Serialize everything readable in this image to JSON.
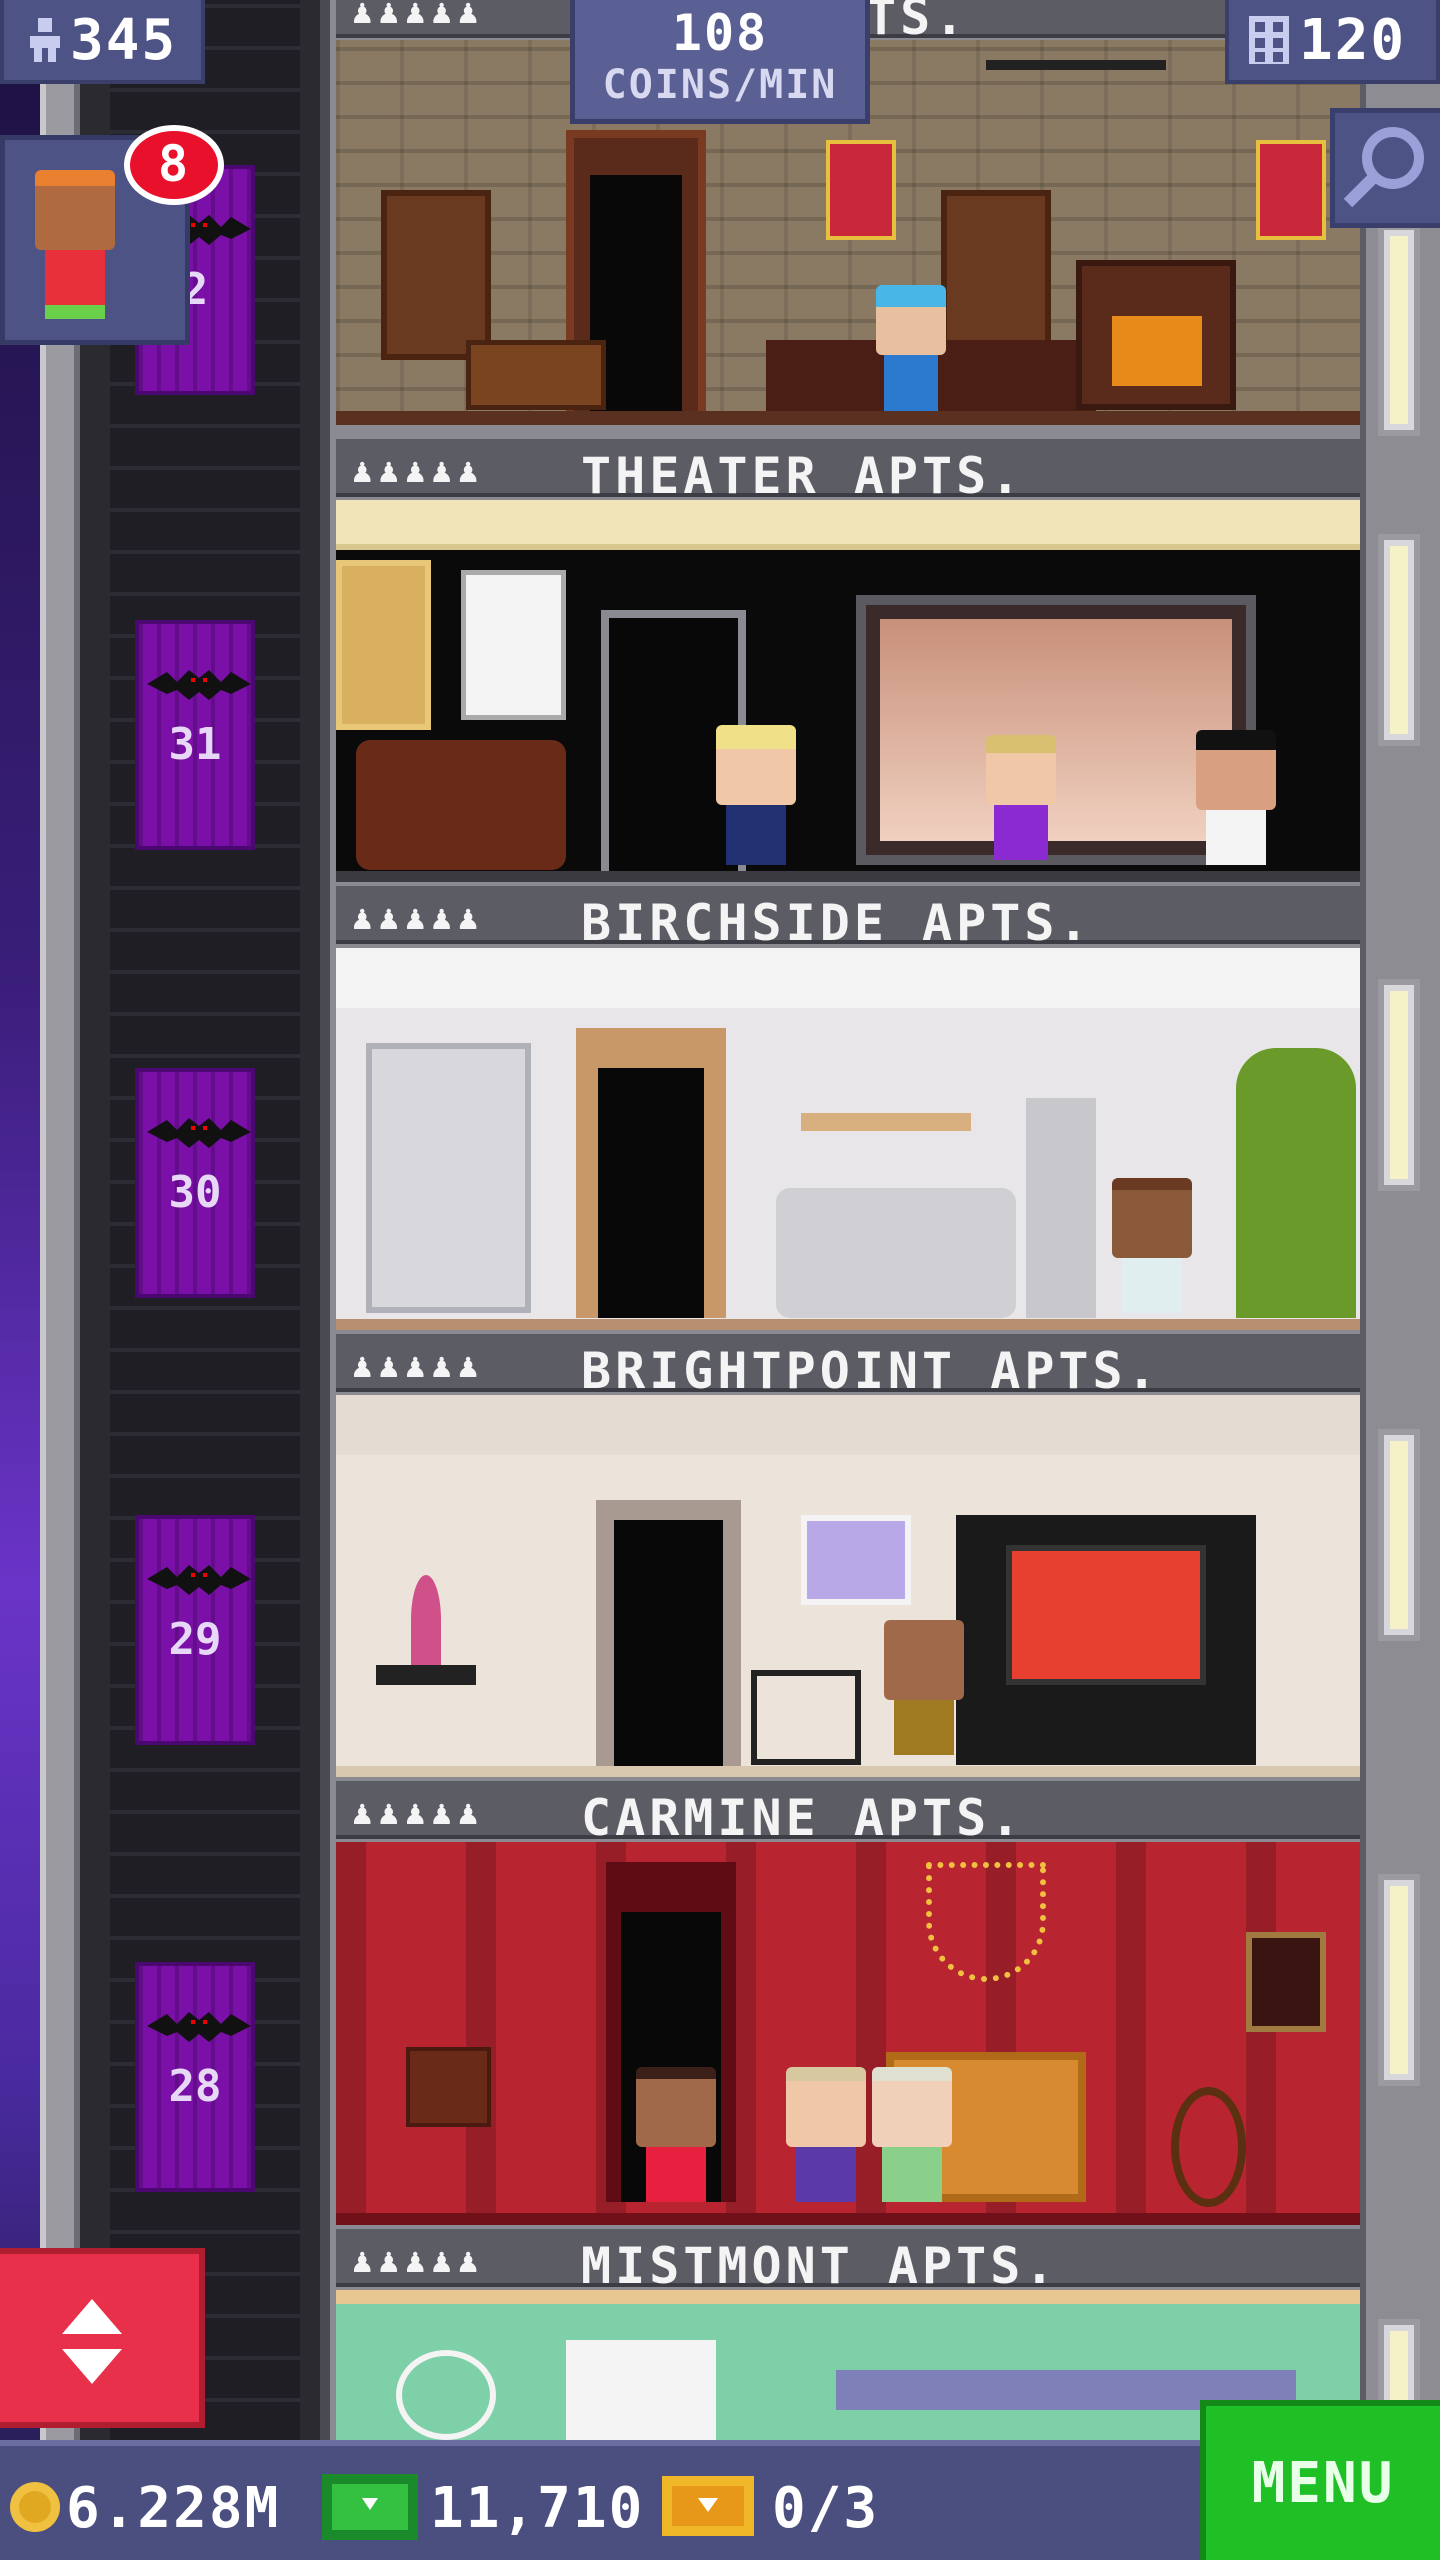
{
  "hud": {
    "population": "345",
    "coins_rate_value": "108",
    "coins_rate_unit": "COINS/MIN",
    "floors": "120",
    "visitor_badge": "8"
  },
  "floors": [
    {
      "name": "TS.",
      "type": "library",
      "people": "♟♟♟♟♟"
    },
    {
      "name": "THEATER APTS.",
      "type": "theater",
      "people": "♟♟♟♟♟"
    },
    {
      "name": "BIRCHSIDE APTS.",
      "type": "birchside",
      "people": "♟♟♟♟♟"
    },
    {
      "name": "BRIGHTPOINT APTS.",
      "type": "brightpoint",
      "people": "♟♟♟♟♟"
    },
    {
      "name": "CARMINE APTS.",
      "type": "carmine",
      "people": "♟♟♟♟♟"
    },
    {
      "name": "MISTMONT APTS.",
      "type": "mistmont",
      "people": "♟♟♟♟♟"
    }
  ],
  "elevator_floor_numbers": [
    "2",
    "31",
    "30",
    "29",
    "28"
  ],
  "bottom": {
    "coins": "6.228M",
    "bux": "11,710",
    "tickets": "0/3",
    "menu_label": "MENU"
  },
  "colors": {
    "hud_panel": "#4e5386",
    "menu_green": "#1fbf26",
    "elevator_button_red": "#e8304a",
    "badge_red": "#e8102a",
    "elevator_purple": "#7a10a8"
  },
  "icons": [
    "person-icon",
    "building-icon",
    "magnifier-icon",
    "coin-icon",
    "bux-icon",
    "ticket-icon",
    "up-down-arrows-icon",
    "bat-icon"
  ]
}
